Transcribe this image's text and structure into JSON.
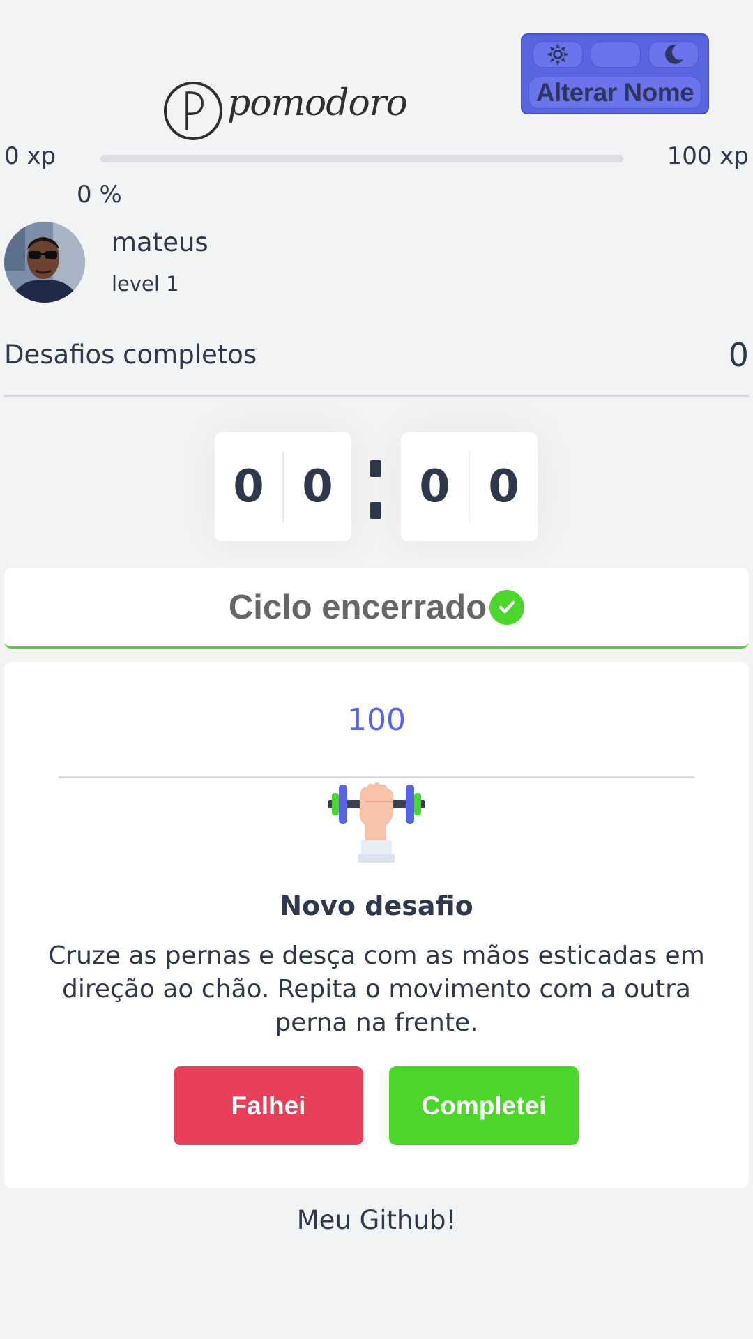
{
  "theme": {
    "light_icon": "sun-icon",
    "dark_icon": "moon-icon",
    "rename_label": "Alterar Nome",
    "accent": "#5965e0"
  },
  "logo": {
    "text": "pomodoro"
  },
  "xp": {
    "current_label": "0 xp",
    "next_level_label": "100 xp",
    "progress_percent_label": "0 %",
    "progress_fraction": 0
  },
  "profile": {
    "name": "mateus",
    "level_label": "level 1"
  },
  "stats": {
    "completed_label": "Desafios completos",
    "completed_count": "0"
  },
  "timer": {
    "minute_left": "0",
    "minute_right": "0",
    "second_left": "0",
    "second_right": "0"
  },
  "cycle": {
    "label": "Ciclo encerrado",
    "status_icon": "check-circle-icon",
    "status_color": "#4cd62b"
  },
  "challenge": {
    "xp": "100",
    "icon": "dumbbell-body-icon",
    "title": "Novo desafio",
    "description": "Cruze as pernas e desça com as mãos esticadas em direção ao chão. Repita o movimento com a outra perna na frente.",
    "fail_label": "Falhei",
    "success_label": "Completei",
    "fail_color": "#e83f5b",
    "success_color": "#4cd62b"
  },
  "footer": {
    "github_label": "Meu Github!"
  }
}
